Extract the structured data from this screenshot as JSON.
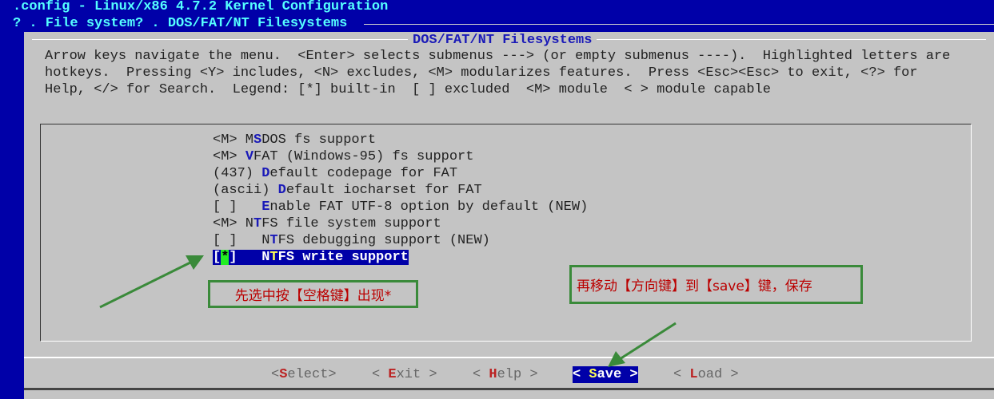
{
  "window": {
    "title": ".config - Linux/x86 4.7.2 Kernel Configuration",
    "breadcrumb": "? . File system? . DOS/FAT/NT Filesystems"
  },
  "dialog": {
    "title": "DOS/FAT/NT Filesystems",
    "help": [
      "Arrow keys navigate the menu.  <Enter> selects submenus ---> (or empty submenus ----).  Highlighted letters are",
      "hotkeys.  Pressing <Y> includes, <N> excludes, <M> modularizes features.  Press <Esc><Esc> to exit, <?> for",
      "Help, </> for Search.  Legend: [*] built-in  [ ] excluded  <M> module  < > module capable"
    ]
  },
  "menu": [
    {
      "pre": "<M> M",
      "hk": "S",
      "post": "DOS fs support"
    },
    {
      "pre": "<M> ",
      "hk": "V",
      "post": "FAT (Windows-95) fs support"
    },
    {
      "pre": "(437) ",
      "hk": "D",
      "post": "efault codepage for FAT"
    },
    {
      "pre": "(ascii) ",
      "hk": "D",
      "post": "efault iocharset for FAT"
    },
    {
      "pre": "[ ]   ",
      "hk": "E",
      "post": "nable FAT UTF-8 option by default (NEW)"
    },
    {
      "pre": "<M> N",
      "hk": "T",
      "post": "FS file system support"
    },
    {
      "pre": "[ ]   N",
      "hk": "T",
      "post": "FS debugging support (NEW)"
    },
    {
      "pre": "[",
      "star": "*",
      "pre2": "]   N",
      "hk": "T",
      "post": "FS write support",
      "selected": true
    }
  ],
  "buttons": [
    {
      "pre": "<",
      "hk": "S",
      "post": "elect>"
    },
    {
      "pre": "< ",
      "hk": "E",
      "post": "xit >"
    },
    {
      "pre": "< ",
      "hk": "H",
      "post": "elp >"
    },
    {
      "pre": "< ",
      "hk": "S",
      "post": "ave >",
      "active": true
    },
    {
      "pre": "< ",
      "hk": "L",
      "post": "oad >"
    }
  ],
  "annotations": {
    "note1": "先选中按【空格键】出现*",
    "note2": "再移动【方向键】到【save】键，保存",
    "color": "#3a8a3a"
  }
}
